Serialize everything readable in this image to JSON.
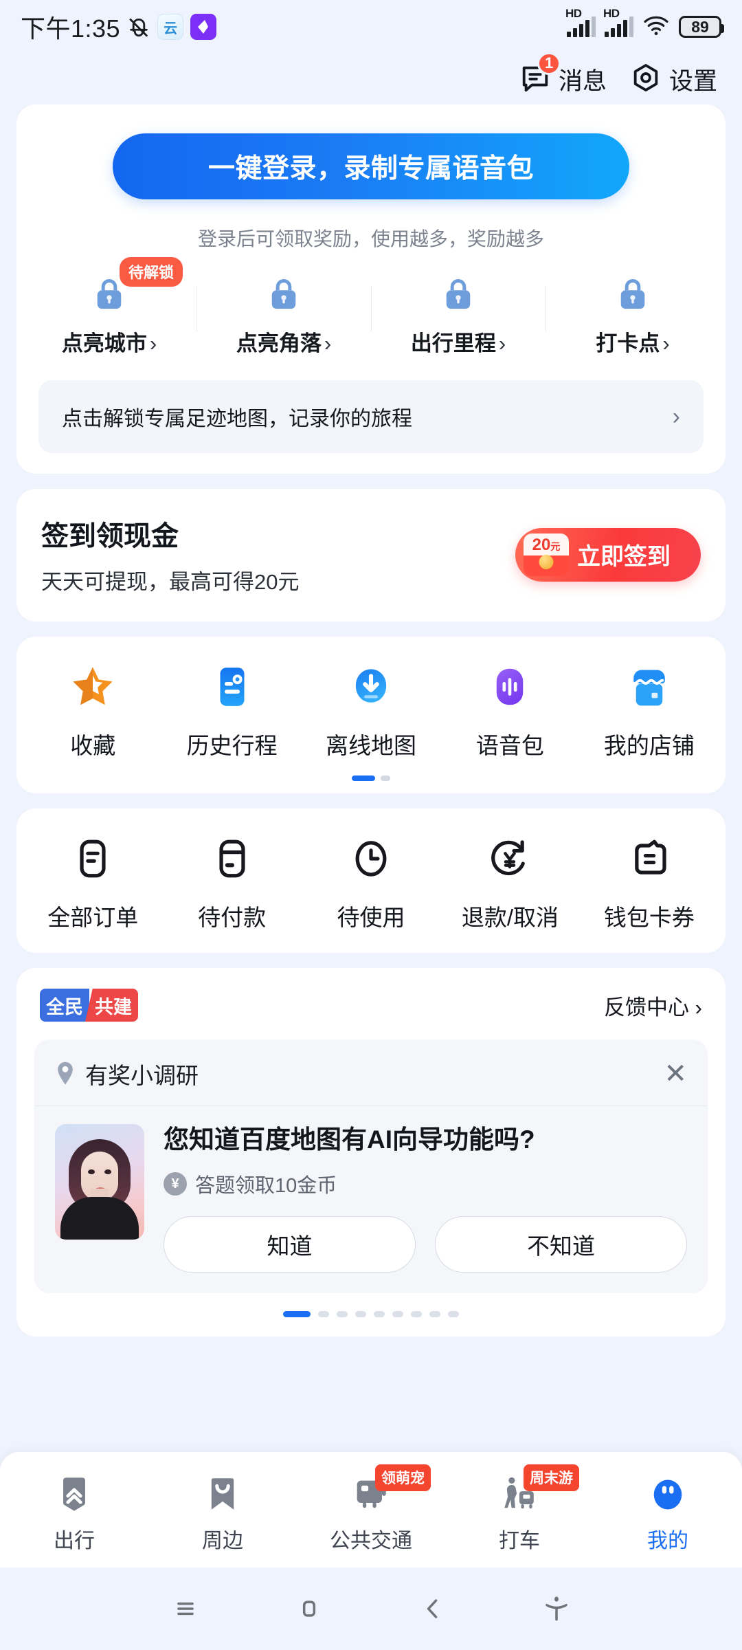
{
  "statusbar": {
    "time": "下午1:35",
    "bell_icon": "bell-muted-icon",
    "app_icons": [
      "cloud-app-icon",
      "violet-app-icon"
    ],
    "signal_label": "HD",
    "wifi_icon": "wifi-icon",
    "battery": "89"
  },
  "header": {
    "messages": {
      "label": "消息",
      "icon": "message-icon",
      "badge": "1"
    },
    "settings": {
      "label": "设置",
      "icon": "gear-hexagon-icon"
    }
  },
  "login_card": {
    "button_label": "一键登录，录制专属语音包",
    "subtitle": "登录后可领取奖励，使用越多，奖励越多",
    "locks": [
      {
        "label": "点亮城市",
        "chevron": "›",
        "badge": "待解锁",
        "icon": "lock-icon"
      },
      {
        "label": "点亮角落",
        "chevron": "›",
        "badge": "",
        "icon": "lock-icon"
      },
      {
        "label": "出行里程",
        "chevron": "›",
        "badge": "",
        "icon": "lock-icon"
      },
      {
        "label": "打卡点",
        "chevron": "›",
        "badge": "",
        "icon": "lock-icon"
      }
    ],
    "footprint": {
      "text": "点击解锁专属足迹地图，记录你的旅程",
      "chevron": "›"
    }
  },
  "signin_card": {
    "title": "签到领现金",
    "subtitle": "天天可提现，最高可得20元",
    "button_label": "立即签到",
    "envelope_amount": "20",
    "envelope_unit": "元"
  },
  "services_card": {
    "items": [
      {
        "label": "收藏",
        "icon": "star-icon"
      },
      {
        "label": "历史行程",
        "icon": "history-route-icon"
      },
      {
        "label": "离线地图",
        "icon": "offline-download-icon"
      },
      {
        "label": "语音包",
        "icon": "voice-pack-icon"
      },
      {
        "label": "我的店铺",
        "icon": "shop-icon"
      }
    ],
    "page_count": 2,
    "active_page": 1
  },
  "orders_card": {
    "items": [
      {
        "label": "全部订单",
        "icon": "order-list-icon"
      },
      {
        "label": "待付款",
        "icon": "card-payment-icon"
      },
      {
        "label": "待使用",
        "icon": "clock-icon"
      },
      {
        "label": "退款/取消",
        "icon": "refund-yuan-icon"
      },
      {
        "label": "钱包卡券",
        "icon": "wallet-coupon-icon"
      }
    ]
  },
  "survey_card": {
    "logo_left": "全民",
    "logo_right": "共建",
    "feedback_label": "反馈中心 ›",
    "panel_title": "有奖小调研",
    "panel_icon": "location-pin-icon",
    "close_icon": "close-icon",
    "question": "您知道百度地图有AI向导功能吗?",
    "reward": "答题领取10金币",
    "reward_icon": "coin-yuan-icon",
    "answers": [
      "知道",
      "不知道"
    ],
    "page_count": 9,
    "active_page": 1
  },
  "tabbar": {
    "items": [
      {
        "label": "出行",
        "icon": "chevrons-up-icon",
        "badge": "",
        "active": false
      },
      {
        "label": "周边",
        "icon": "bookmark-icon",
        "badge": "",
        "active": false
      },
      {
        "label": "公共交通",
        "icon": "bus-icon",
        "badge": "领萌宠",
        "active": false
      },
      {
        "label": "打车",
        "icon": "hail-taxi-icon",
        "badge": "周末游",
        "active": false
      },
      {
        "label": "我的",
        "icon": "profile-icon",
        "badge": "",
        "active": true
      }
    ]
  },
  "androidnav": {
    "items": [
      "menu-icon",
      "home-icon",
      "back-icon",
      "accessibility-icon"
    ]
  },
  "colors": {
    "page_bg": "#eff3fd",
    "brand_blue": "#1a6ef2",
    "accent_red": "#f4452f",
    "signin_red": "#fa3a3a"
  }
}
